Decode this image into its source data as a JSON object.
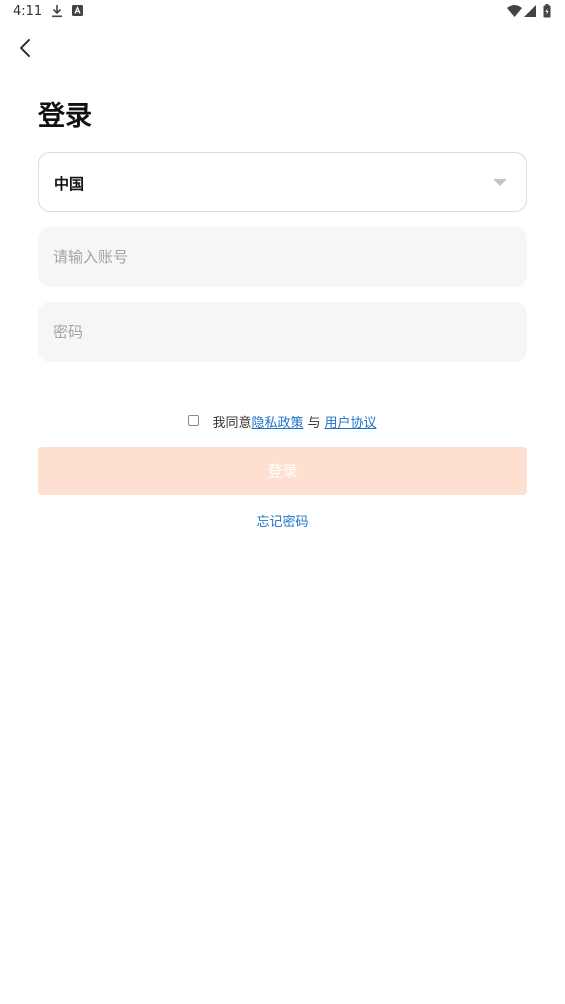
{
  "status_bar": {
    "time": "4:11",
    "icons": [
      "download-icon",
      "a-icon",
      "wifi-icon",
      "signal-icon",
      "battery-icon"
    ]
  },
  "header": {
    "back_icon": "chevron-left-icon"
  },
  "page": {
    "title": "登录"
  },
  "form": {
    "country": "中国",
    "account_placeholder": "请输入账号",
    "password_placeholder": "密码"
  },
  "agreement": {
    "prefix": "我同意",
    "privacy_link": "隐私政策",
    "connector": "与",
    "terms_link": "用户协议",
    "checked": false
  },
  "actions": {
    "login_label": "登录",
    "forgot_label": "忘记密码"
  },
  "colors": {
    "link": "#1e73c9",
    "login_button_bg": "#fee0d0",
    "field_bg": "#f6f6f6"
  }
}
